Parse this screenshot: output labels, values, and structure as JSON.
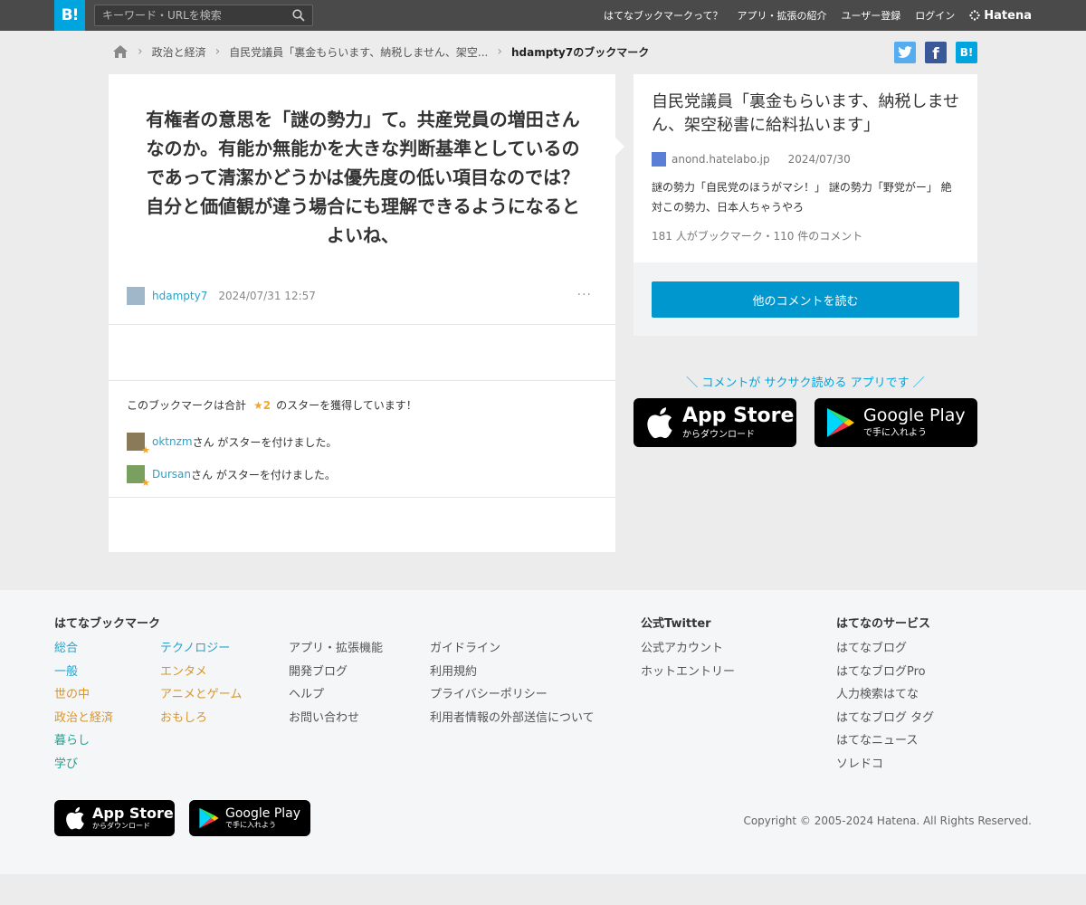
{
  "header": {
    "logo": "B!",
    "search_placeholder": "キーワード・URLを検索",
    "nav": [
      "はてなブックマークって？",
      "アプリ・拡張の紹介",
      "ユーザー登録",
      "ログイン"
    ],
    "brand": "Hatena"
  },
  "breadcrumb": {
    "items": [
      "政治と経済",
      "自民党議員「裏金もらいます、納税しません、架空..."
    ],
    "current": "hdampty7のブックマーク"
  },
  "share": {
    "b": "B!"
  },
  "bookmark": {
    "comment": "有権者の意思を「謎の勢力」て。共産党員の増田さんなのか。有能か無能かを大きな判断基準としているのであって清潔かどうかは優先度の低い項目なのでは？自分と価値観が違う場合にも理解できるようになるとよいね、",
    "user": "hdampty7",
    "date": "2024/07/31 12:57",
    "more": "···",
    "stars_prefix": "このブックマークは合計",
    "stars_count": "★2",
    "stars_suffix": "のスターを獲得しています！",
    "star_users": [
      {
        "user": "oktnzm",
        "text": "さん がスターを付けました。"
      },
      {
        "user": "Dursan",
        "text": "さん がスターを付けました。"
      }
    ]
  },
  "entry": {
    "title": "自民党議員「裏金もらいます、納税しません、架空秘書に給料払います」",
    "domain": "anond.hatelabo.jp",
    "date": "2024/07/30",
    "excerpt": "謎の勢力「自民党のほうがマシ！」 謎の勢力「野党がー」 絶対この勢力、日本人ちゃうやろ",
    "count": "181 人がブックマーク・110 件のコメント",
    "read_button": "他のコメントを読む"
  },
  "promo": {
    "text": "＼ コメントが サクサク読める アプリです ／",
    "appstore_main": "App Store",
    "appstore_sub": "からダウンロード",
    "googleplay_main": "Google Play",
    "googleplay_sub": "で手に入れよう"
  },
  "footer": {
    "bookmark_heading": "はてなブックマーク",
    "categories1": [
      "総合",
      "一般",
      "世の中",
      "政治と経済",
      "暮らし",
      "学び"
    ],
    "categories2": [
      "テクノロジー",
      "エンタメ",
      "アニメとゲーム",
      "おもしろ"
    ],
    "links1": [
      "アプリ・拡張機能",
      "開発ブログ",
      "ヘルプ",
      "お問い合わせ"
    ],
    "links2": [
      "ガイドライン",
      "利用規約",
      "プライバシーポリシー",
      "利用者情報の外部送信について"
    ],
    "twitter_heading": "公式Twitter",
    "twitter_links": [
      "公式アカウント",
      "ホットエントリー"
    ],
    "services_heading": "はてなのサービス",
    "services": [
      "はてなブログ",
      "はてなブログPro",
      "人力検索はてな",
      "はてなブログ タグ",
      "はてなニュース",
      "ソレドコ"
    ],
    "copyright": "Copyright © 2005-2024 Hatena. All Rights Reserved."
  },
  "colors": {
    "accent": "#00a4de",
    "button": "#0097cf",
    "link": "#2aa0c8",
    "star": "#f5a623",
    "twitter": "#55acee",
    "facebook": "#3b5998"
  }
}
